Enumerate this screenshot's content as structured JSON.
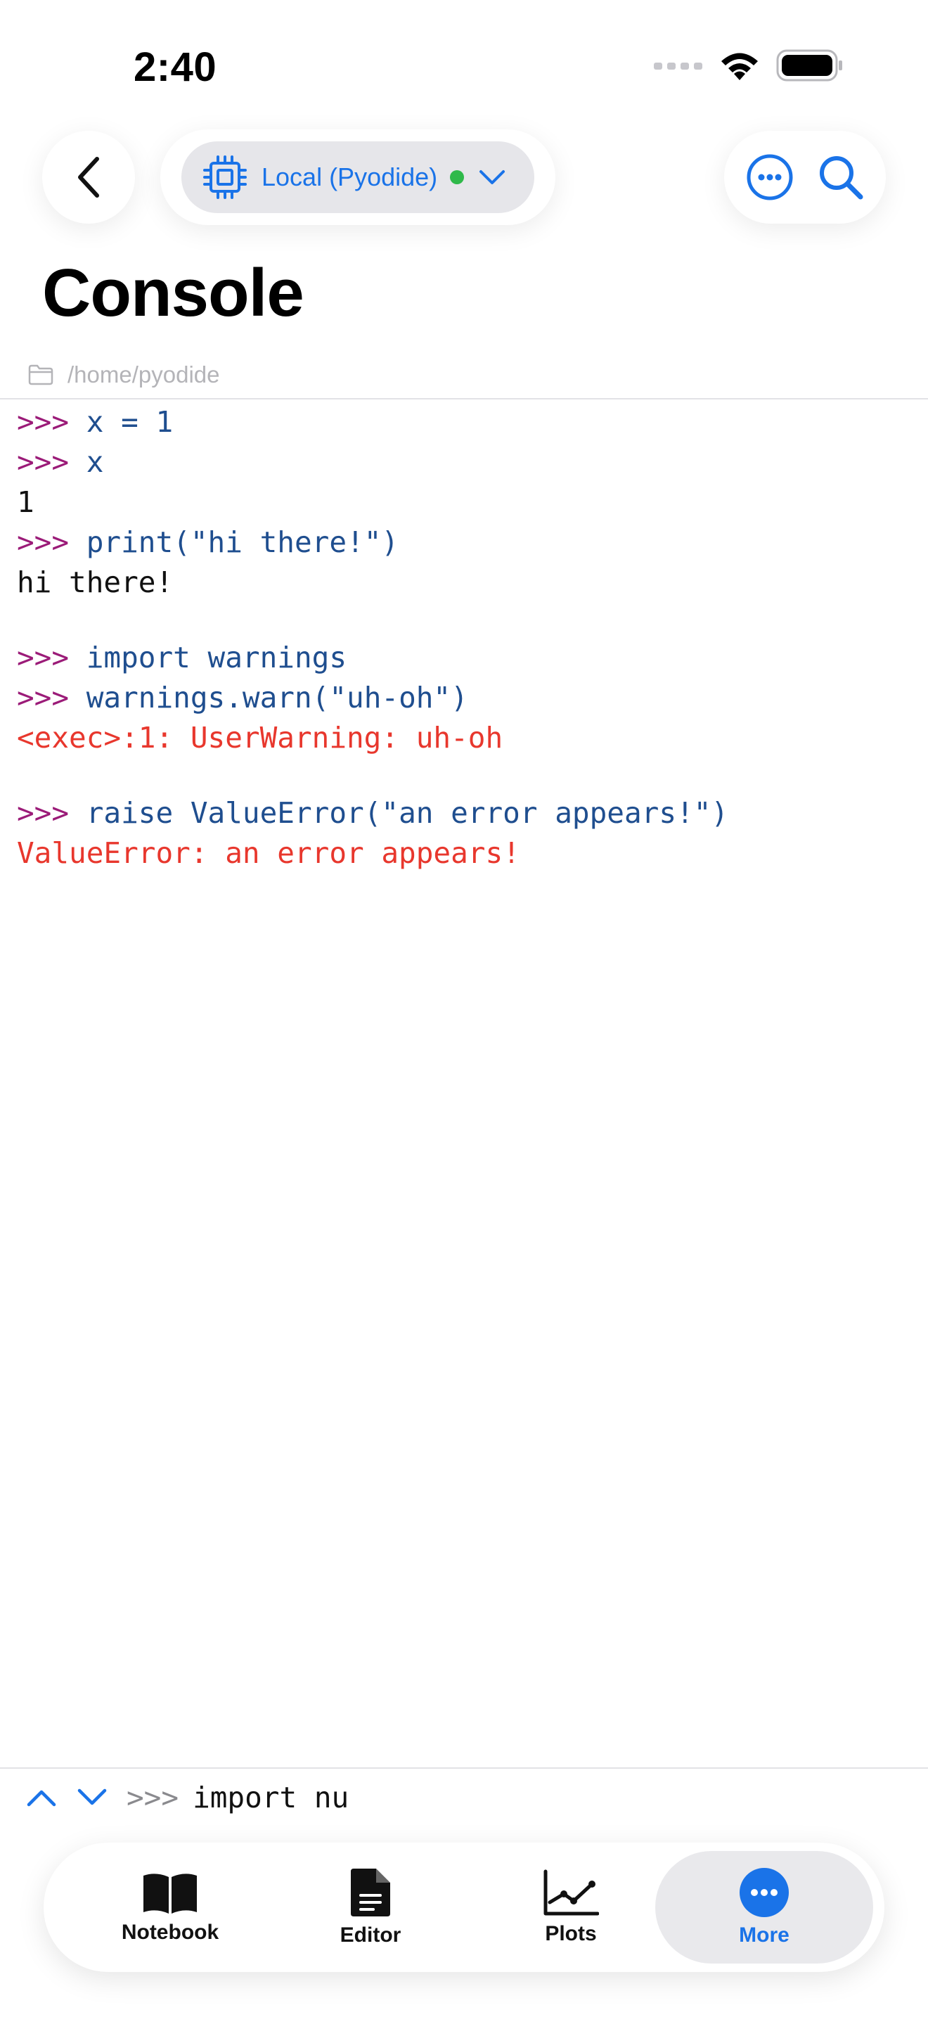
{
  "status_bar": {
    "time": "2:40"
  },
  "header": {
    "kernel_label": "Local (Pyodide)",
    "kernel_status_color": "#2fb94a",
    "title": "Console"
  },
  "path": {
    "text": "/home/pyodide"
  },
  "console": {
    "prompt": ">>>",
    "lines": [
      {
        "kind": "input",
        "text": "x = 1"
      },
      {
        "kind": "input",
        "text": "x"
      },
      {
        "kind": "output",
        "text": "1"
      },
      {
        "kind": "input",
        "text": "print(\"hi there!\")"
      },
      {
        "kind": "output",
        "text": "hi there!"
      },
      {
        "kind": "input",
        "text": "import warnings"
      },
      {
        "kind": "input",
        "text": "warnings.warn(\"uh-oh\")"
      },
      {
        "kind": "error",
        "text": "<exec>:1: UserWarning: uh-oh"
      },
      {
        "kind": "input",
        "text": "raise ValueError(\"an error appears!\")"
      },
      {
        "kind": "error",
        "text": "ValueError: an error appears!"
      }
    ]
  },
  "input_bar": {
    "prompt": ">>>",
    "value": "import nu"
  },
  "tabs": [
    {
      "label": "Notebook",
      "icon": "book-icon",
      "active": false
    },
    {
      "label": "Editor",
      "icon": "document-icon",
      "active": false
    },
    {
      "label": "Plots",
      "icon": "chart-line-icon",
      "active": false
    },
    {
      "label": "More",
      "icon": "more-circle-icon",
      "active": true
    }
  ],
  "colors": {
    "accent": "#1a73e8",
    "prompt": "#9b1b78",
    "input": "#1f4e8f",
    "error": "#e8372d"
  }
}
